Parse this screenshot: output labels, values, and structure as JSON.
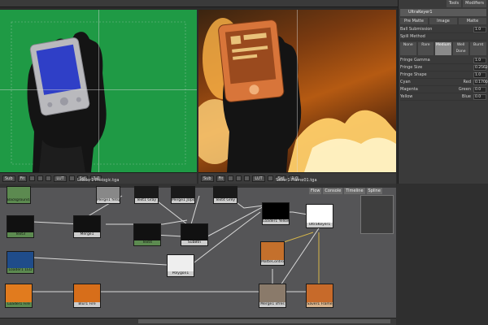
{
  "panel": {
    "tabs": [
      "Tools",
      "Modifiers"
    ],
    "title": "UltraKeyer1",
    "subtabs": [
      "Pre Matte",
      "Image",
      "Matte"
    ],
    "rows": [
      {
        "label": "Ball Submission",
        "value": "1.0"
      },
      {
        "label": "Spill Method",
        "value": ""
      }
    ],
    "spill_buttons": [
      "None",
      "Rare",
      "Medium",
      "Well Done",
      "Burnt"
    ],
    "rows2": [
      {
        "label": "Fringe Gamma",
        "value": "1.0"
      },
      {
        "label": "Fringe Size",
        "value": "0.25628"
      },
      {
        "label": "Fringe Shape",
        "value": "1.0"
      },
      {
        "label": "Cyan",
        "unit": "Red",
        "value": "0.170016"
      },
      {
        "label": "Magenta",
        "unit": "Green",
        "value": "0.0"
      },
      {
        "label": "Yellow",
        "unit": "Blue",
        "value": "0.0"
      }
    ]
  },
  "viewerL": {
    "label": "Loader1 Prologic.tga",
    "toolbar": [
      "Sub",
      "Fit",
      "LUT",
      "Sel",
      "2.0"
    ]
  },
  "viewerR": {
    "label": "Saver1 Flame01.tga",
    "toolbar": [
      "Sub",
      "Fit",
      "LUT",
      "Sel",
      "1.0"
    ]
  },
  "flow": {
    "tabs": [
      "Flow",
      "Console",
      "Timeline",
      "Spline"
    ],
    "nodes": [
      {
        "id": "n_bg1",
        "label": "Background1"
      },
      {
        "id": "n_merge1",
        "label": "Merge1 fetsp"
      },
      {
        "id": "n_text1",
        "label": "Text1 Gray"
      },
      {
        "id": "n_merge2",
        "label": "Merge1 JUps"
      },
      {
        "id": "n_text2",
        "label": "Text4 Grey"
      },
      {
        "id": "n_text3",
        "label": "Text3"
      },
      {
        "id": "n_mergeA",
        "label": "Merge1"
      },
      {
        "id": "n_text4",
        "label": "Text4"
      },
      {
        "id": "n_sub",
        "label": "SubBtn"
      },
      {
        "id": "n_loader",
        "label": "Loader1 Yellowgreen"
      },
      {
        "id": "n_loader2",
        "label": "Loader1 1ED"
      },
      {
        "id": "n_poly",
        "label": "Polygon1"
      },
      {
        "id": "n_ultra",
        "label": "UltraKeyer1"
      },
      {
        "id": "n_matte",
        "label": "MatteControl"
      },
      {
        "id": "n_cc",
        "label": "ColorCorr"
      },
      {
        "id": "n_fire1",
        "label": "Loader1 Fire"
      },
      {
        "id": "n_blur",
        "label": "Blur1 Fire"
      },
      {
        "id": "n_merge3",
        "label": "Merge1 xfres"
      },
      {
        "id": "n_saver",
        "label": "Saver1 Flame"
      }
    ]
  },
  "colors": {
    "green_screen": "#1f9a45",
    "node_bg": "#555557",
    "panel": "#3a3a3a",
    "link_white": "#d9d9d9",
    "link_yellow": "#d8b84a"
  }
}
